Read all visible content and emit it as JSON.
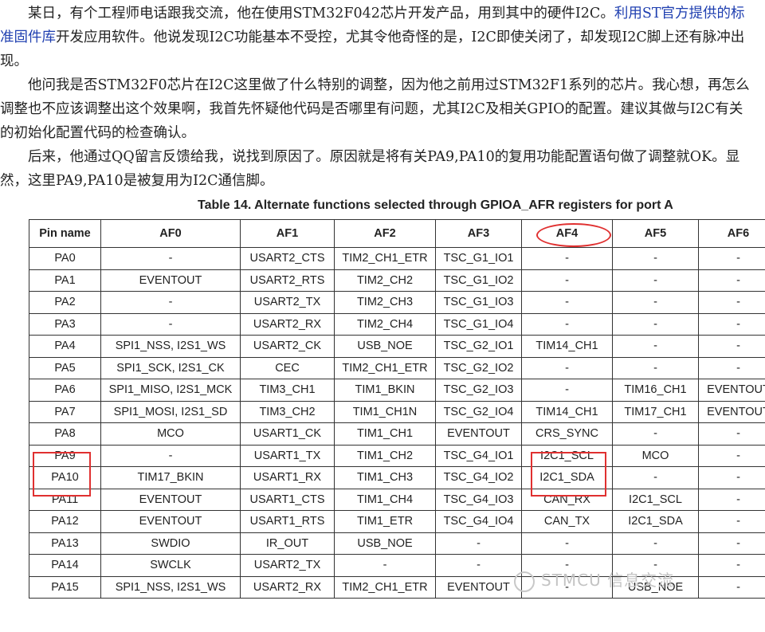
{
  "article": {
    "p1_a": "某日，有个工程师电话跟我交流，他在使用STM32F042芯片开发产品，用到其中的硬件I2C。",
    "p1_link": "利用ST官方提供的标准固件库",
    "p1_b": "开发应用软件。他说发现I2C功能基本不受控，尤其令他奇怪的是，I2C即使关闭了，却发现I2C脚上还有脉冲出现。",
    "p2": "他问我是否STM32F0芯片在I2C这里做了什么特别的调整，因为他之前用过STM32F1系列的芯片。我心想，再怎么调整也不应该调整出这个效果啊，我首先怀疑他代码是否哪里有问题，尤其I2C及相关GPIO的配置。建议其做与I2C有关的初始化配置代码的检查确认。",
    "p3": "后来，他通过QQ留言反馈给我，说找到原因了。原因就是将有关PA9,PA10的复用功能配置语句做了调整就OK。显然，这里PA9,PA10是被复用为I2C通信脚。"
  },
  "table": {
    "caption": "Table 14. Alternate functions selected through GPIOA_AFR registers for port A",
    "headers": [
      "Pin name",
      "AF0",
      "AF1",
      "AF2",
      "AF3",
      "AF4",
      "AF5",
      "AF6"
    ],
    "rows": [
      [
        "PA0",
        "-",
        "USART2_CTS",
        "TIM2_CH1_ETR",
        "TSC_G1_IO1",
        "-",
        "-",
        "-"
      ],
      [
        "PA1",
        "EVENTOUT",
        "USART2_RTS",
        "TIM2_CH2",
        "TSC_G1_IO2",
        "-",
        "-",
        "-"
      ],
      [
        "PA2",
        "-",
        "USART2_TX",
        "TIM2_CH3",
        "TSC_G1_IO3",
        "-",
        "-",
        "-"
      ],
      [
        "PA3",
        "-",
        "USART2_RX",
        "TIM2_CH4",
        "TSC_G1_IO4",
        "-",
        "-",
        "-"
      ],
      [
        "PA4",
        "SPI1_NSS, I2S1_WS",
        "USART2_CK",
        "USB_NOE",
        "TSC_G2_IO1",
        "TIM14_CH1",
        "-",
        "-"
      ],
      [
        "PA5",
        "SPI1_SCK, I2S1_CK",
        "CEC",
        "TIM2_CH1_ETR",
        "TSC_G2_IO2",
        "-",
        "-",
        "-"
      ],
      [
        "PA6",
        "SPI1_MISO, I2S1_MCK",
        "TIM3_CH1",
        "TIM1_BKIN",
        "TSC_G2_IO3",
        "-",
        "TIM16_CH1",
        "EVENTOUT"
      ],
      [
        "PA7",
        "SPI1_MOSI, I2S1_SD",
        "TIM3_CH2",
        "TIM1_CH1N",
        "TSC_G2_IO4",
        "TIM14_CH1",
        "TIM17_CH1",
        "EVENTOUT"
      ],
      [
        "PA8",
        "MCO",
        "USART1_CK",
        "TIM1_CH1",
        "EVENTOUT",
        "CRS_SYNC",
        "-",
        "-"
      ],
      [
        "PA9",
        "-",
        "USART1_TX",
        "TIM1_CH2",
        "TSC_G4_IO1",
        "I2C1_SCL",
        "MCO",
        "-"
      ],
      [
        "PA10",
        "TIM17_BKIN",
        "USART1_RX",
        "TIM1_CH3",
        "TSC_G4_IO2",
        "I2C1_SDA",
        "-",
        "-"
      ],
      [
        "PA11",
        "EVENTOUT",
        "USART1_CTS",
        "TIM1_CH4",
        "TSC_G4_IO3",
        "CAN_RX",
        "I2C1_SCL",
        "-"
      ],
      [
        "PA12",
        "EVENTOUT",
        "USART1_RTS",
        "TIM1_ETR",
        "TSC_G4_IO4",
        "CAN_TX",
        "I2C1_SDA",
        "-"
      ],
      [
        "PA13",
        "SWDIO",
        "IR_OUT",
        "USB_NOE",
        "-",
        "-",
        "-",
        "-"
      ],
      [
        "PA14",
        "SWCLK",
        "USART2_TX",
        "-",
        "-",
        "-",
        "-",
        "-"
      ],
      [
        "PA15",
        "SPI1_NSS, I2S1_WS",
        "USART2_RX",
        "TIM2_CH1_ETR",
        "EVENTOUT",
        "-",
        "USB_NOE",
        "-"
      ]
    ]
  },
  "watermark": {
    "text": "STMCU 信息交流"
  },
  "colors": {
    "link": "#1f3fb0",
    "highlight": "#e03030"
  }
}
